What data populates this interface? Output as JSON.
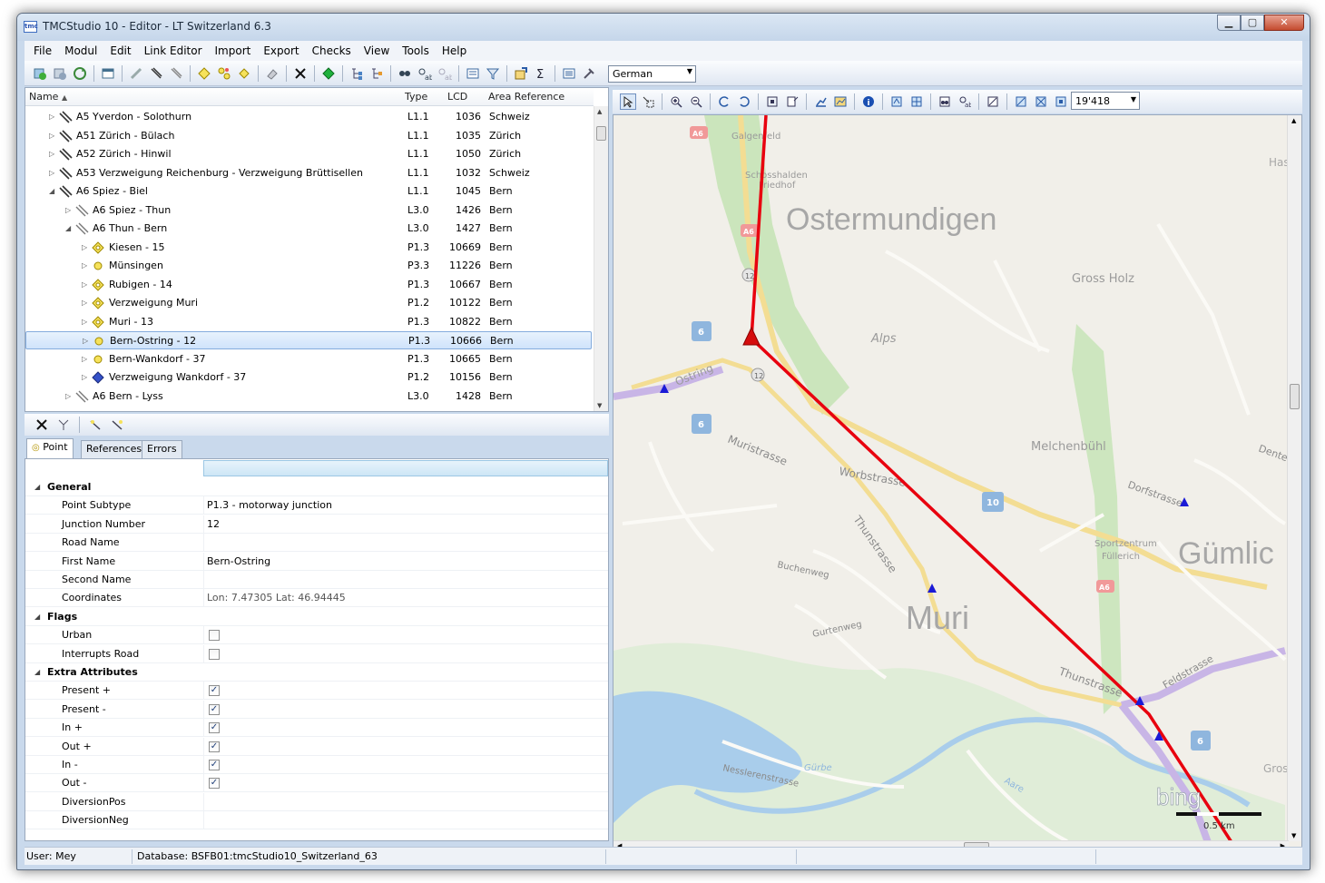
{
  "window": {
    "title": "TMCStudio 10 - Editor - LT Switzerland 6.3",
    "logo_text": "tmc"
  },
  "menu": [
    "File",
    "Modul",
    "Edit",
    "Link Editor",
    "Import",
    "Export",
    "Checks",
    "View",
    "Tools",
    "Help"
  ],
  "language_select": {
    "value": "German"
  },
  "tree": {
    "columns": {
      "name": "Name",
      "type": "Type",
      "lcd": "LCD",
      "area": "Area Reference"
    },
    "rows": [
      {
        "level": 1,
        "expander": "▷",
        "icon": "road-link-icon",
        "name": "A5 Yverdon - Solothurn",
        "type": "L1.1",
        "lcd": "1036",
        "area": "Schweiz"
      },
      {
        "level": 1,
        "expander": "▷",
        "icon": "road-link-icon",
        "name": "A51 Zürich - Bülach",
        "type": "L1.1",
        "lcd": "1035",
        "area": "Zürich"
      },
      {
        "level": 1,
        "expander": "▷",
        "icon": "road-link-icon",
        "name": "A52 Zürich - Hinwil",
        "type": "L1.1",
        "lcd": "1050",
        "area": "Zürich"
      },
      {
        "level": 1,
        "expander": "▷",
        "icon": "road-link-icon",
        "name": "A53 Verzweigung Reichenburg - Verzweigung Brüttisellen",
        "type": "L1.1",
        "lcd": "1032",
        "area": "Schweiz"
      },
      {
        "level": 1,
        "expander": "◢",
        "icon": "road-link-icon",
        "name": "A6 Spiez - Biel",
        "type": "L1.1",
        "lcd": "1045",
        "area": "Bern"
      },
      {
        "level": 2,
        "expander": "▷",
        "icon": "road-segment-icon",
        "name": "A6 Spiez - Thun",
        "type": "L3.0",
        "lcd": "1426",
        "area": "Bern"
      },
      {
        "level": 2,
        "expander": "◢",
        "icon": "road-segment-icon",
        "name": "A6 Thun - Bern",
        "type": "L3.0",
        "lcd": "1427",
        "area": "Bern"
      },
      {
        "level": 3,
        "expander": "▷",
        "icon": "junction-point-icon",
        "name": "Kiesen - 15",
        "type": "P1.3",
        "lcd": "10669",
        "area": "Bern"
      },
      {
        "level": 3,
        "expander": "▷",
        "icon": "point-icon",
        "name": "Münsingen",
        "type": "P3.3",
        "lcd": "11226",
        "area": "Bern"
      },
      {
        "level": 3,
        "expander": "▷",
        "icon": "junction-point-icon",
        "name": "Rubigen - 14",
        "type": "P1.3",
        "lcd": "10667",
        "area": "Bern"
      },
      {
        "level": 3,
        "expander": "▷",
        "icon": "junction-point-icon",
        "name": "Verzweigung Muri",
        "type": "P1.2",
        "lcd": "10122",
        "area": "Bern"
      },
      {
        "level": 3,
        "expander": "▷",
        "icon": "junction-point-icon",
        "name": "Muri - 13",
        "type": "P1.3",
        "lcd": "10822",
        "area": "Bern"
      },
      {
        "level": 3,
        "expander": "▷",
        "icon": "point-icon",
        "name": "Bern-Ostring - 12",
        "type": "P1.3",
        "lcd": "10666",
        "area": "Bern",
        "selected": true
      },
      {
        "level": 3,
        "expander": "▷",
        "icon": "point-icon",
        "name": "Bern-Wankdorf - 37",
        "type": "P1.3",
        "lcd": "10665",
        "area": "Bern"
      },
      {
        "level": 3,
        "expander": "▷",
        "icon": "blue-junction-icon",
        "name": "Verzweigung Wankdorf - 37",
        "type": "P1.2",
        "lcd": "10156",
        "area": "Bern"
      },
      {
        "level": 2,
        "expander": "▷",
        "icon": "road-segment-icon",
        "name": "A6 Bern - Lyss",
        "type": "L3.0",
        "lcd": "1428",
        "area": "Bern"
      }
    ]
  },
  "tabs": [
    "Point",
    "References",
    "Errors"
  ],
  "properties": [
    {
      "kind": "section",
      "name": "General"
    },
    {
      "kind": "text",
      "name": "Point Subtype",
      "value": "P1.3 - motorway junction"
    },
    {
      "kind": "text",
      "name": "Junction Number",
      "value": "12"
    },
    {
      "kind": "text",
      "name": "Road Name",
      "value": ""
    },
    {
      "kind": "text",
      "name": "First Name",
      "value": "Bern-Ostring"
    },
    {
      "kind": "text",
      "name": "Second Name",
      "value": ""
    },
    {
      "kind": "text",
      "name": "Coordinates",
      "value": "Lon: 7.47305   Lat: 46.94445",
      "grey": true
    },
    {
      "kind": "section",
      "name": "Flags"
    },
    {
      "kind": "check",
      "name": "Urban",
      "checked": false
    },
    {
      "kind": "check",
      "name": "Interrupts Road",
      "checked": false
    },
    {
      "kind": "section",
      "name": "Extra Attributes"
    },
    {
      "kind": "check",
      "name": "Present +",
      "checked": true
    },
    {
      "kind": "check",
      "name": "Present -",
      "checked": true
    },
    {
      "kind": "check",
      "name": "In +",
      "checked": true
    },
    {
      "kind": "check",
      "name": "Out +",
      "checked": true
    },
    {
      "kind": "check",
      "name": "In -",
      "checked": true
    },
    {
      "kind": "check",
      "name": "Out -",
      "checked": true
    },
    {
      "kind": "text",
      "name": "DiversionPos",
      "value": ""
    },
    {
      "kind": "text",
      "name": "DiversionNeg",
      "value": ""
    }
  ],
  "map": {
    "zoom": "19'418",
    "labels": {
      "ostermundigen": "Ostermundigen",
      "muri": "Muri",
      "gumlig": "Gümlic",
      "gross_holz": "Gross Holz",
      "alps": "Alps",
      "melchenbuhl": "Melchenbühl",
      "galgenfeld": "Galgenfeld",
      "schosshalden": "Schosshalden",
      "friedhof": "Friedhof",
      "ostring": "Ostring",
      "muristrasse": "Muristrasse",
      "worbstrasse": "Worbstrasse",
      "thunstrasse": "Thunstrasse",
      "thunstrasse2": "Thunstrasse",
      "dorfstrasse": "Dorfstrasse",
      "feldstrasse": "Feldstrasse",
      "buchenweg": "Buchenweg",
      "gurtenweg": "Gurtenweg",
      "nesslerenstrasse": "Nesslerenstrasse",
      "dentenberg": "Dentenb",
      "sportzentrum": "Sportzentrum",
      "fullerich": "Füllerich",
      "gurbe": "Gürbe",
      "aare": "Aare",
      "gros": "Gros",
      "has": "Has",
      "bing": "bing",
      "scale": "0.5 km"
    }
  },
  "status": {
    "user": "User:  Mey",
    "database": "Database:  BSFB01:tmcStudio10_Switzerland_63"
  }
}
